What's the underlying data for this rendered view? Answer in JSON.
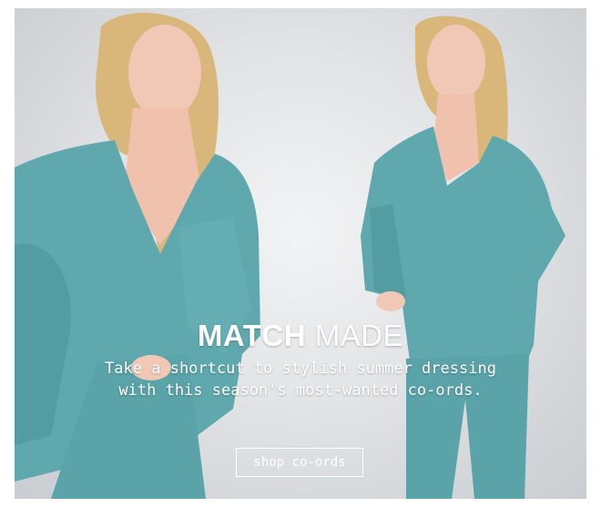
{
  "hero": {
    "headline_bold": "MATCH",
    "headline_light": "MADE",
    "subcopy": "Take a shortcut to stylish summer dressing with this season's most-wanted co-ords.",
    "cta_label": "shop co-ords"
  },
  "colors": {
    "background": "#dfe1e3",
    "garment": "#5fa8ad",
    "hair": "#d9b77a",
    "skin": "#f1c8b6",
    "text": "#ffffff"
  }
}
